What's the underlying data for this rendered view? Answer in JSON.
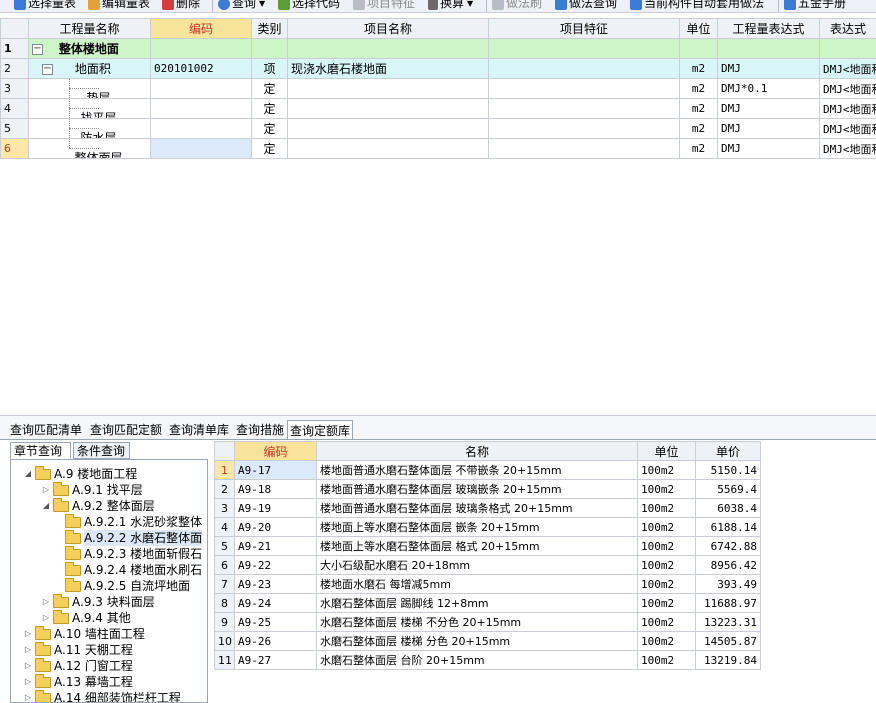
{
  "toolbar": {
    "items": [
      {
        "label": "选择量表",
        "icon": "select-table-icon",
        "color": "#3b7bd6",
        "disabled": false
      },
      {
        "label": "编辑量表",
        "icon": "edit-table-icon",
        "color": "#e3a13b",
        "disabled": false
      },
      {
        "label": "删除",
        "icon": "delete-icon",
        "color": "#d43b3b",
        "disabled": false
      },
      {
        "label": "查询",
        "icon": "query-icon",
        "color": "#3b7bd6",
        "disabled": false,
        "dropdown": true
      },
      {
        "label": "选择代码",
        "icon": "select-code-icon",
        "color": "#5a9e3a",
        "disabled": false
      },
      {
        "label": "项目特征",
        "icon": "item-feature-icon",
        "color": "#9aa0a6",
        "disabled": true
      },
      {
        "label": "换算",
        "icon": "convert-icon",
        "color": "#555555",
        "disabled": false,
        "dropdown": true
      },
      {
        "label": "做法刷",
        "icon": "method-brush-icon",
        "color": "#9aa0a6",
        "disabled": true
      },
      {
        "label": "做法查询",
        "icon": "method-query-icon",
        "color": "#3b7bd6",
        "disabled": false
      },
      {
        "label": "当前构件自动套用做法",
        "icon": "auto-apply-icon",
        "color": "#3b7bd6",
        "disabled": false
      },
      {
        "label": "五金手册",
        "icon": "hardware-manual-icon",
        "color": "#3b7bd6",
        "disabled": false
      }
    ]
  },
  "main_grid": {
    "headers": [
      "",
      "工程量名称",
      "编码",
      "类别",
      "项目名称",
      "项目特征",
      "单位",
      "工程量表达式",
      "表达式"
    ],
    "rows": [
      {
        "num": "1",
        "name": "整体楼地面",
        "code": "",
        "type": "",
        "project": "",
        "feature": "",
        "unit": "",
        "expr": "",
        "desc": "",
        "level": 0
      },
      {
        "num": "2",
        "name": "地面积",
        "code": "020101002",
        "type": "项",
        "project": "现浇水磨石楼地面",
        "feature": "",
        "unit": "m2",
        "expr": "DMJ",
        "desc": "DMJ<地面积",
        "level": 1
      },
      {
        "num": "3",
        "name": "垫层",
        "code": "",
        "type": "定",
        "project": "",
        "feature": "",
        "unit": "m2",
        "expr": "DMJ*0.1",
        "desc": "DMJ<地面积",
        "level": 2
      },
      {
        "num": "4",
        "name": "找平层",
        "code": "",
        "type": "定",
        "project": "",
        "feature": "",
        "unit": "m2",
        "expr": "DMJ",
        "desc": "DMJ<地面积",
        "level": 2
      },
      {
        "num": "5",
        "name": "防水层",
        "code": "",
        "type": "定",
        "project": "",
        "feature": "",
        "unit": "m2",
        "expr": "DMJ",
        "desc": "DMJ<地面积",
        "level": 2
      },
      {
        "num": "6",
        "name": "整体面层",
        "code": "",
        "type": "定",
        "project": "",
        "feature": "",
        "unit": "m2",
        "expr": "DMJ",
        "desc": "DMJ<地面积",
        "level": 2
      }
    ]
  },
  "bottom_tabs": [
    "查询匹配清单",
    "查询匹配定额",
    "查询清单库",
    "查询措施",
    "查询定额库"
  ],
  "left_tabs": [
    "章节查询",
    "条件查询"
  ],
  "tree": [
    {
      "label": "A.9 楼地面工程",
      "indent": 0,
      "open": true
    },
    {
      "label": "A.9.1 找平层",
      "indent": 1,
      "open": false
    },
    {
      "label": "A.9.2 整体面层",
      "indent": 1,
      "open": true
    },
    {
      "label": "A.9.2.1 水泥砂浆整体",
      "indent": 2,
      "leaf": true
    },
    {
      "label": "A.9.2.2 水磨石整体面",
      "indent": 2,
      "leaf": true,
      "selected": true
    },
    {
      "label": "A.9.2.3 楼地面斩假石",
      "indent": 2,
      "leaf": true
    },
    {
      "label": "A.9.2.4 楼地面水刷石",
      "indent": 2,
      "leaf": true
    },
    {
      "label": "A.9.2.5 自流坪地面",
      "indent": 2,
      "leaf": true
    },
    {
      "label": "A.9.3 块料面层",
      "indent": 1,
      "open": false
    },
    {
      "label": "A.9.4 其他",
      "indent": 1,
      "open": false
    },
    {
      "label": "A.10 墙柱面工程",
      "indent": 0,
      "open": false
    },
    {
      "label": "A.11 天棚工程",
      "indent": 0,
      "open": false
    },
    {
      "label": "A.12 门窗工程",
      "indent": 0,
      "open": false
    },
    {
      "label": "A.13 幕墙工程",
      "indent": 0,
      "open": false
    },
    {
      "label": "A.14 细部装饰栏杆工程",
      "indent": 0,
      "open": false
    }
  ],
  "result_grid": {
    "headers": [
      "",
      "编码",
      "名称",
      "单位",
      "单价"
    ],
    "rows": [
      {
        "num": "1",
        "code": "A9-17",
        "name": "楼地面普通水磨石整体面层 不带嵌条 20+15mm",
        "unit": "100m2",
        "price": "5150.14"
      },
      {
        "num": "2",
        "code": "A9-18",
        "name": "楼地面普通水磨石整体面层 玻璃嵌条 20+15mm",
        "unit": "100m2",
        "price": "5569.4"
      },
      {
        "num": "3",
        "code": "A9-19",
        "name": "楼地面普通水磨石整体面层 玻璃条格式 20+15mm",
        "unit": "100m2",
        "price": "6038.4"
      },
      {
        "num": "4",
        "code": "A9-20",
        "name": "楼地面上等水磨石整体面层 嵌条 20+15mm",
        "unit": "100m2",
        "price": "6188.14"
      },
      {
        "num": "5",
        "code": "A9-21",
        "name": "楼地面上等水磨石整体面层 格式 20+15mm",
        "unit": "100m2",
        "price": "6742.88"
      },
      {
        "num": "6",
        "code": "A9-22",
        "name": "大小石级配水磨石 20+18mm",
        "unit": "100m2",
        "price": "8956.42"
      },
      {
        "num": "7",
        "code": "A9-23",
        "name": "楼地面水磨石 每增减5mm",
        "unit": "100m2",
        "price": "393.49"
      },
      {
        "num": "8",
        "code": "A9-24",
        "name": "水磨石整体面层 踢脚线 12+8mm",
        "unit": "100m2",
        "price": "11688.97"
      },
      {
        "num": "9",
        "code": "A9-25",
        "name": "水磨石整体面层 楼梯 不分色 20+15mm",
        "unit": "100m2",
        "price": "13223.31"
      },
      {
        "num": "10",
        "code": "A9-26",
        "name": "水磨石整体面层 楼梯 分色 20+15mm",
        "unit": "100m2",
        "price": "14505.87"
      },
      {
        "num": "11",
        "code": "A9-27",
        "name": "水磨石整体面层 台阶 20+15mm",
        "unit": "100m2",
        "price": "13219.84"
      }
    ]
  },
  "colors": {
    "group_row": "#cdf5c7",
    "item_row": "#d8f6f8",
    "code_header": "#f8e39b",
    "selection": "#dce9fb"
  }
}
